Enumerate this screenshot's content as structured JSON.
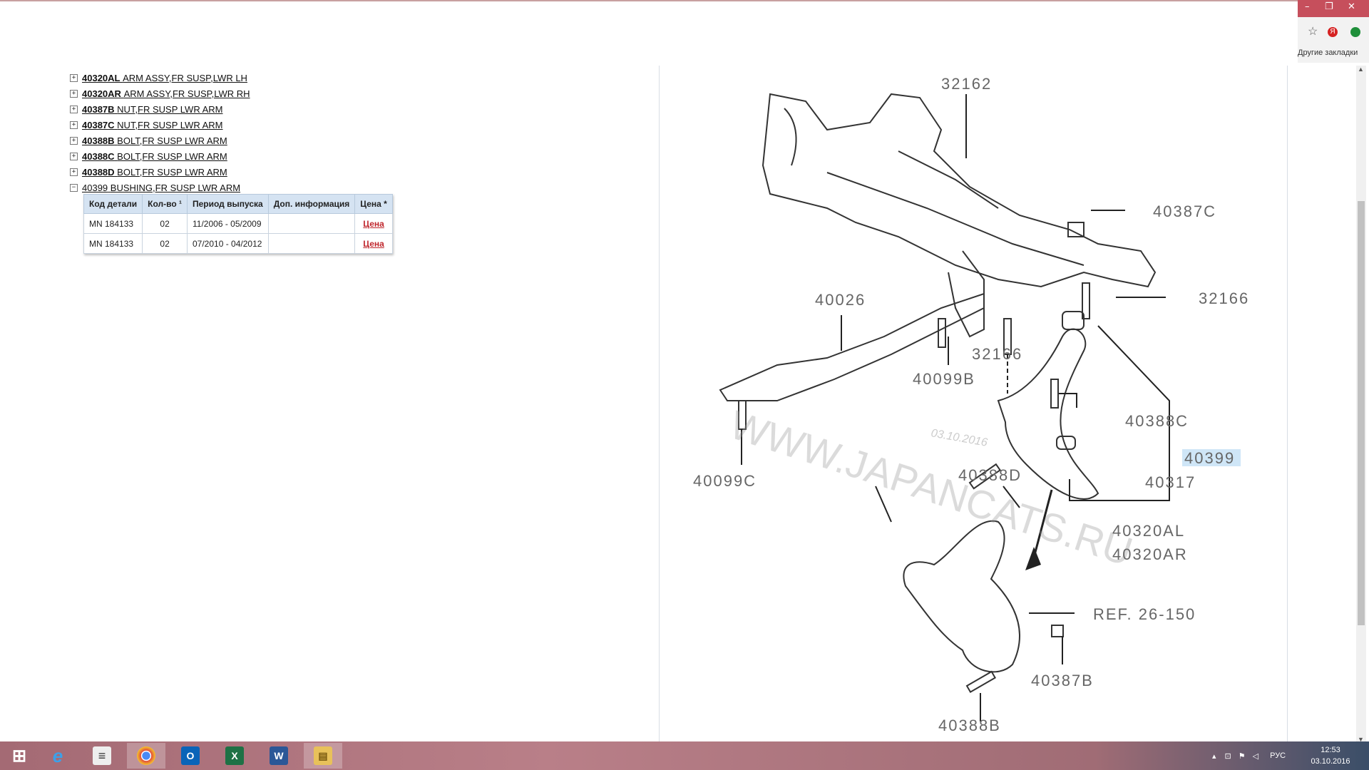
{
  "browser": {
    "window_controls": [
      "–",
      "❐",
      "✕"
    ],
    "bookmarks_label": "Другие закладки"
  },
  "tree": [
    {
      "toggle": "+",
      "code": "40320AL",
      "desc": "ARM ASSY,FR SUSP,LWR LH"
    },
    {
      "toggle": "+",
      "code": "40320AR",
      "desc": "ARM ASSY,FR SUSP,LWR RH"
    },
    {
      "toggle": "+",
      "code": "40387B",
      "desc": "NUT,FR SUSP LWR ARM"
    },
    {
      "toggle": "+",
      "code": "40387C",
      "desc": "NUT,FR SUSP LWR ARM"
    },
    {
      "toggle": "+",
      "code": "40388B",
      "desc": "BOLT,FR SUSP LWR ARM"
    },
    {
      "toggle": "+",
      "code": "40388C",
      "desc": "BOLT,FR SUSP LWR ARM"
    },
    {
      "toggle": "+",
      "code": "40388D",
      "desc": "BOLT,FR SUSP LWR ARM"
    },
    {
      "toggle": "−",
      "code": "40399",
      "desc": "BUSHING,FR SUSP LWR ARM"
    }
  ],
  "parts_table": {
    "headers": [
      "Код детали",
      "Кол-во ¹",
      "Период выпуска",
      "Доп. информация",
      "Цена *"
    ],
    "rows": [
      {
        "code": "MN 184133",
        "qty": "02",
        "period": "11/2006 - 05/2009",
        "info": "",
        "price": "Цена"
      },
      {
        "code": "MN 184133",
        "qty": "02",
        "period": "07/2010 - 04/2012",
        "info": "",
        "price": "Цена"
      }
    ]
  },
  "diagram": {
    "labels": {
      "l32162": "32162",
      "l40387C": "40387C",
      "l32166a": "32166",
      "l40026": "40026",
      "l32166b": "32166",
      "l40099B": "40099B",
      "l40388C": "40388C",
      "l40399": "40399",
      "l40099C": "40099C",
      "l40388D": "40388D",
      "l40317": "40317",
      "l40320AL": "40320AL",
      "l40320AR": "40320AR",
      "lref": "REF. 26-150",
      "l40387B": "40387B",
      "l40388B": "40388B"
    },
    "watermark": "WWW.JAPANCATS.RU",
    "watermark_date": "03.10.2016",
    "highlight_color": "#cfe6f7"
  },
  "taskbar": {
    "apps": [
      {
        "name": "start",
        "label": "⊞"
      },
      {
        "name": "ie",
        "label": "e"
      },
      {
        "name": "notes",
        "label": "≡"
      },
      {
        "name": "chrome",
        "label": "●"
      },
      {
        "name": "outlook",
        "label": "O"
      },
      {
        "name": "excel",
        "label": "X"
      },
      {
        "name": "word",
        "label": "W"
      },
      {
        "name": "explorer",
        "label": "▤"
      }
    ],
    "lang": "РУС",
    "time": "12:53",
    "date": "03.10.2016"
  }
}
